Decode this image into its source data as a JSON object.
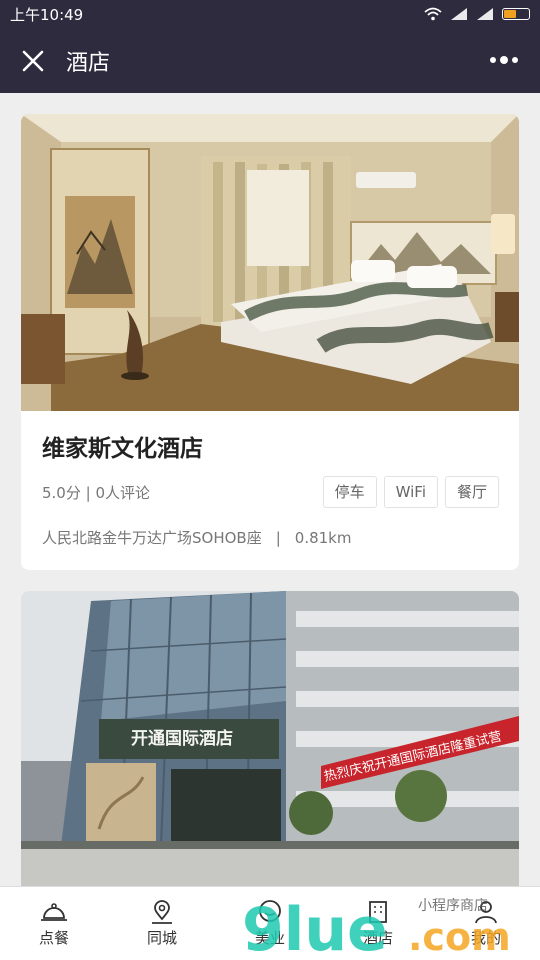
{
  "status_bar": {
    "time": "上午10:49"
  },
  "header": {
    "title": "酒店"
  },
  "hotels": [
    {
      "name": "维家斯文化酒店",
      "rating": "5.0分 | 0人评论",
      "tags": [
        "停车",
        "WiFi",
        "餐厅"
      ],
      "address": "人民北路金牛万达广场SOHOB座",
      "separator": "|",
      "distance": "0.81km"
    },
    {
      "building_sign": "开通国际酒店",
      "banner_text": "热烈庆祝开通国际酒店隆重试营"
    }
  ],
  "tabbar": {
    "items": [
      {
        "label": "点餐",
        "icon": "cloche-icon"
      },
      {
        "label": "同城",
        "icon": "location-pin-icon"
      },
      {
        "label": "美业",
        "icon": "face-icon"
      },
      {
        "label": "酒店",
        "icon": "hotel-icon"
      },
      {
        "label": "我的",
        "icon": "user-icon"
      }
    ]
  },
  "watermark": {
    "logo": "9lue",
    "suffix": ".com",
    "caption": "小程序商店"
  }
}
